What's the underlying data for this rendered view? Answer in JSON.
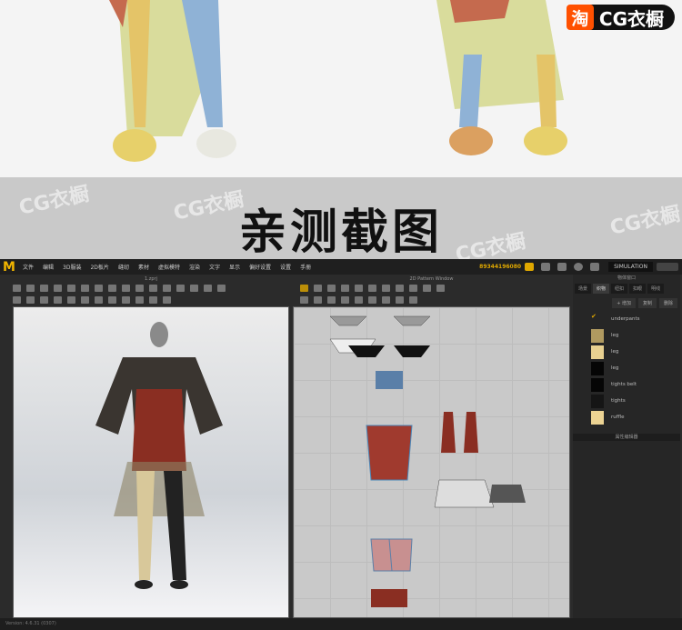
{
  "brand": {
    "tao_char": "淘",
    "name": "CG衣橱"
  },
  "banner": {
    "title": "亲测截图",
    "watermark": "CG衣橱"
  },
  "app": {
    "logo": "M",
    "menu": [
      "文件",
      "编辑",
      "3D服装",
      "2D板片",
      "缝纫",
      "素材",
      "虚拟模特",
      "渲染",
      "文字",
      "显示",
      "偏好设置",
      "设置",
      "手册"
    ],
    "serial": "89344196080",
    "simulation": "SIMULATION",
    "view3d_title": "1.zprj",
    "view2d_title": "2D Pattern Window",
    "object_browser": {
      "title": "物体窗口",
      "tabs": [
        "场景",
        "织物",
        "纽扣",
        "扣眼",
        "明线"
      ],
      "active_tab": 1,
      "buttons": [
        "+ 增加",
        "复制",
        "删除"
      ],
      "fabrics": [
        {
          "name": "underpants",
          "color": "#222"
        },
        {
          "name": "leg",
          "color": "#b09a60"
        },
        {
          "name": "leg",
          "color": "#e8d090"
        },
        {
          "name": "leg",
          "color": "#050505"
        },
        {
          "name": "tights belt",
          "color": "#050505"
        },
        {
          "name": "tights",
          "color": "#151515"
        },
        {
          "name": "ruffle",
          "color": "#ecd393"
        }
      ]
    },
    "property_editor": "属性编辑器",
    "version": "Version: 4.6.31 (0307)"
  }
}
